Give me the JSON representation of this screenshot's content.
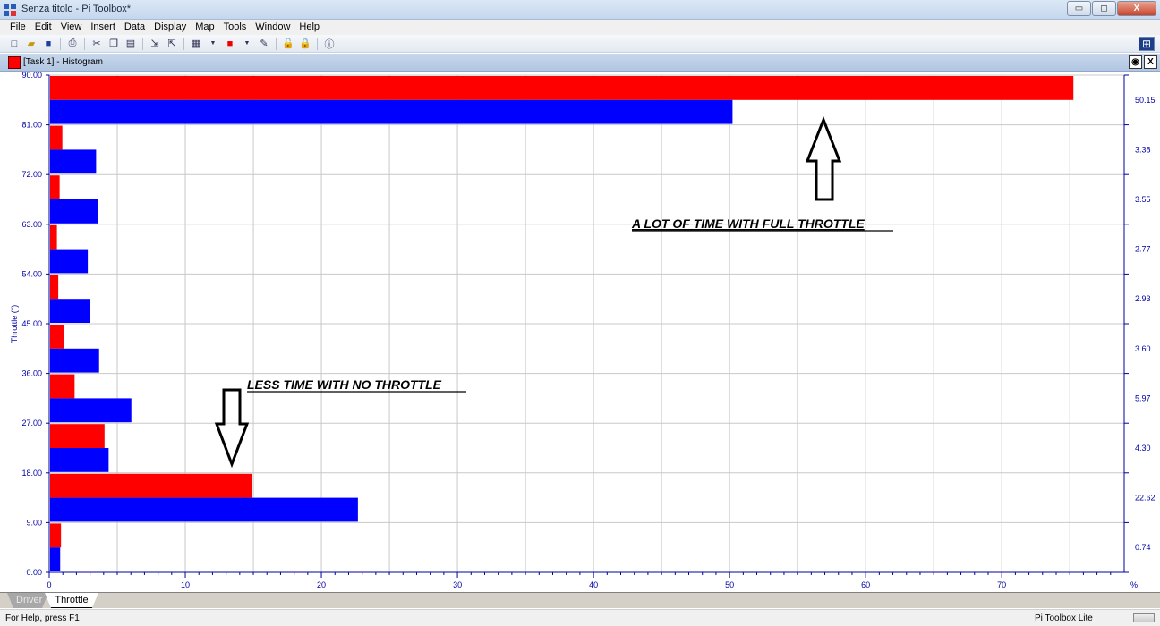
{
  "window": {
    "title": "Senza titolo - Pi Toolbox*",
    "minimize": "▭",
    "maximize": "◻",
    "close": "X"
  },
  "menu": [
    "File",
    "Edit",
    "View",
    "Insert",
    "Data",
    "Display",
    "Map",
    "Tools",
    "Window",
    "Help"
  ],
  "toolbar_icons": [
    "new-icon",
    "open-icon",
    "save-icon",
    "print-icon",
    "cut-icon",
    "copy-icon",
    "paste-icon",
    "import-icon",
    "export-icon",
    "layout-icon",
    "color-icon",
    "pen-icon",
    "lock-open-icon",
    "lock-icon",
    "info-icon"
  ],
  "document": {
    "title": "[Task 1] - Histogram",
    "pin_icon": "◉",
    "close_icon": "X"
  },
  "annotations": {
    "full": "A LOT OF TIME WITH FULL THROTTLE",
    "none": "LESS TIME WITH NO THROTTLE"
  },
  "tabs": [
    "Driver",
    "Throttle"
  ],
  "status": {
    "left": "For Help, press F1",
    "right": "Pi Toolbox Lite"
  },
  "chart_data": {
    "type": "bar",
    "orientation": "horizontal",
    "ylabel": "Throttle (°)",
    "xlabel": "%",
    "y_ticks": [
      "90.00",
      "81.00",
      "72.00",
      "63.00",
      "54.00",
      "45.00",
      "36.00",
      "27.00",
      "18.00",
      "9.00",
      "0.00"
    ],
    "x_ticks": [
      "0",
      "10",
      "20",
      "30",
      "40",
      "50",
      "60",
      "70"
    ],
    "xlim": [
      0,
      79
    ],
    "bins": [
      {
        "red": 0.8,
        "blue": 0.74,
        "label": "0.74"
      },
      {
        "red": 14.8,
        "blue": 22.62,
        "label": "22.62"
      },
      {
        "red": 4.0,
        "blue": 4.3,
        "label": "4.30"
      },
      {
        "red": 1.8,
        "blue": 5.97,
        "label": "5.97"
      },
      {
        "red": 1.0,
        "blue": 3.6,
        "label": "3.60"
      },
      {
        "red": 0.6,
        "blue": 2.93,
        "label": "2.93"
      },
      {
        "red": 0.5,
        "blue": 2.77,
        "label": "2.77"
      },
      {
        "red": 0.7,
        "blue": 3.55,
        "label": "3.55"
      },
      {
        "red": 0.9,
        "blue": 3.38,
        "label": "3.38"
      },
      {
        "red": 75.2,
        "blue": 50.15,
        "label": "50.15"
      }
    ],
    "colors": {
      "red": "#ff0000",
      "blue": "#0000ff",
      "axis": "#0000a0",
      "grid": "#c8c8c8"
    }
  }
}
